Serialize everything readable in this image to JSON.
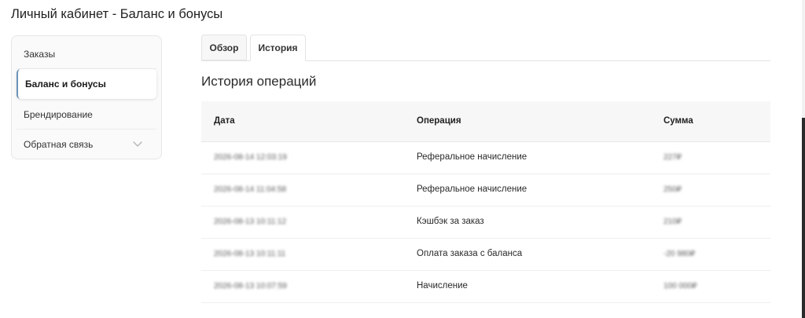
{
  "page": {
    "title": "Личный кабинет - Баланс и бонусы"
  },
  "sidebar": {
    "items": [
      {
        "label": "Заказы"
      },
      {
        "label": "Баланс и бонусы"
      },
      {
        "label": "Брендирование"
      },
      {
        "label": "Обратная связь"
      }
    ]
  },
  "tabs": [
    {
      "label": "Обзор"
    },
    {
      "label": "История"
    }
  ],
  "section": {
    "title": "История операций"
  },
  "table": {
    "headers": [
      "Дата",
      "Операция",
      "Сумма"
    ],
    "rows": [
      {
        "date": "2026-08-14 12:03:19",
        "operation": "Реферальное начисление",
        "amount": "227₽"
      },
      {
        "date": "2026-08-14 11:04:58",
        "operation": "Реферальное начисление",
        "amount": "250₽"
      },
      {
        "date": "2026-08-13 10:11:12",
        "operation": "Кэшбэк за заказ",
        "amount": "210₽"
      },
      {
        "date": "2026-08-13 10:11:11",
        "operation": "Оплата заказа с баланса",
        "amount": "-20 980₽"
      },
      {
        "date": "2026-08-13 10:07:59",
        "operation": "Начисление",
        "amount": "100 000₽"
      }
    ]
  },
  "colors": {
    "active_accent": "#6b93b8",
    "header_bg": "#f7f7f7",
    "border": "#e4e4e4"
  },
  "icons": {
    "dropdown": "chevron-down-icon"
  }
}
